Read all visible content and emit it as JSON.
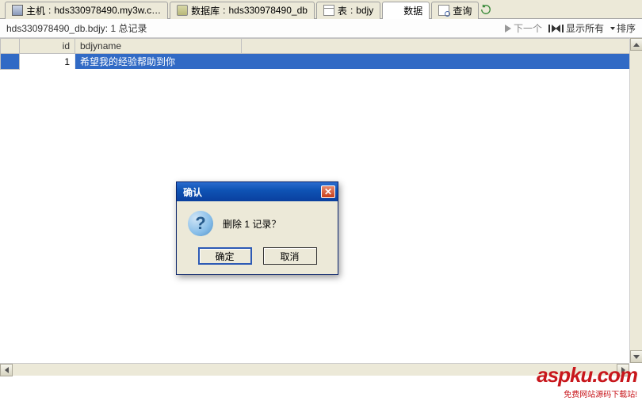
{
  "tabs": {
    "host": {
      "label": "主机",
      "value": "hds330978490.my3w.c…"
    },
    "database": {
      "label": "数据库",
      "value": "hds330978490_db"
    },
    "table": {
      "label": "表",
      "value": "bdjy"
    },
    "data": {
      "label": "数据"
    },
    "query": {
      "label": "查询"
    }
  },
  "breadcrumb": {
    "path": "hds330978490_db.bdjy: 1 总记录",
    "next": "下一个",
    "show_all": "显示所有",
    "sort": "排序"
  },
  "columns": {
    "id": "id",
    "name": "bdjyname"
  },
  "rows": [
    {
      "id": "1",
      "name": "希望我的经验帮助到你"
    }
  ],
  "dialog": {
    "title": "确认",
    "message": "删除 1 记录？",
    "ok": "确定",
    "cancel": "取消"
  },
  "logo": {
    "brand": "aspku",
    "tld": ".com",
    "sub": "免费网站源码下载站!"
  }
}
